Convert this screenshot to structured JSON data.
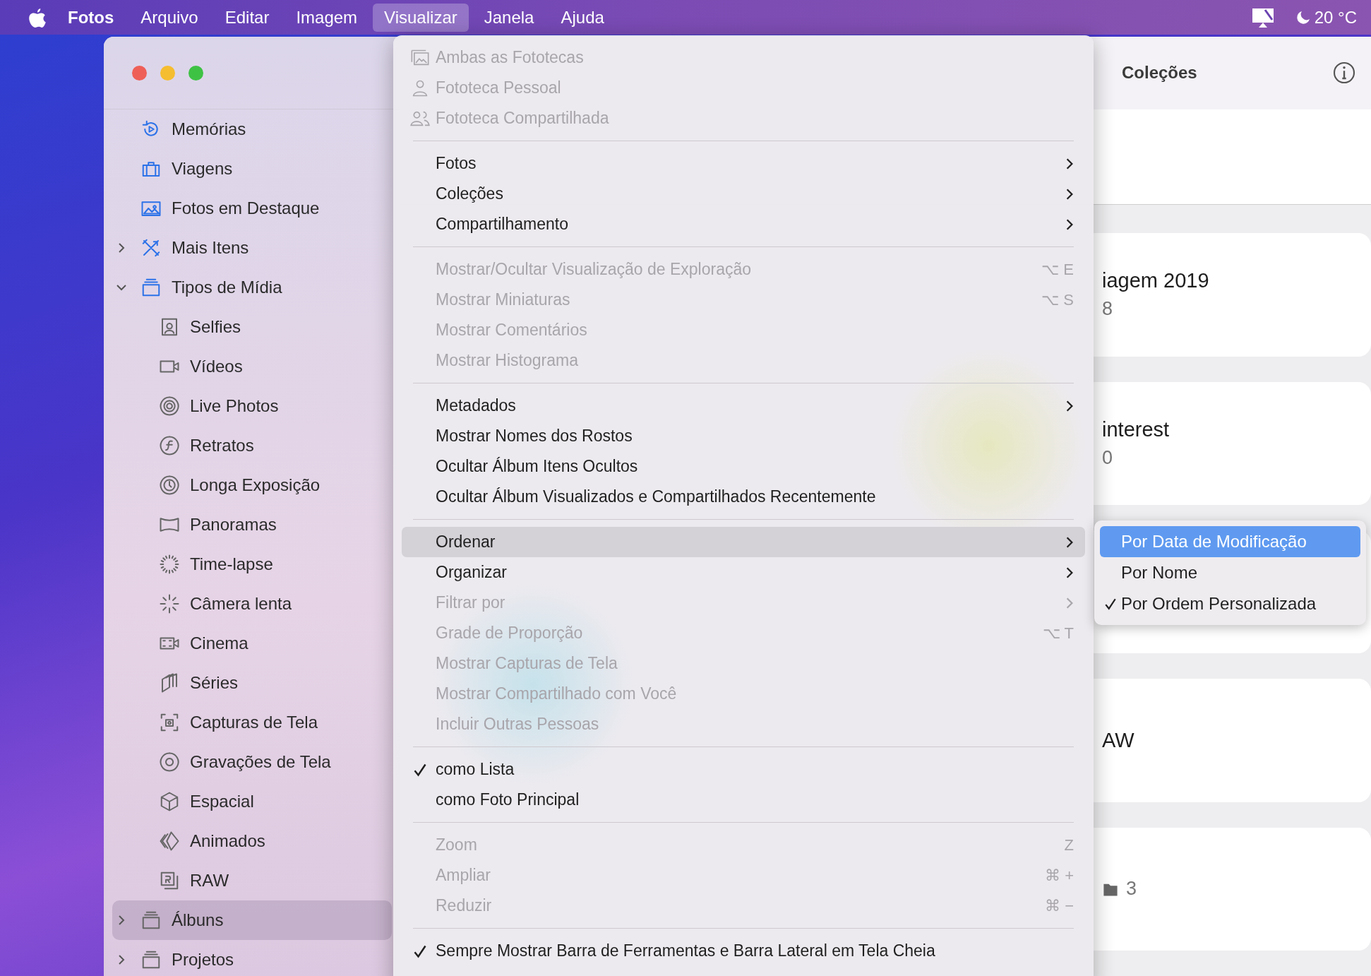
{
  "menu_bar": {
    "app": "Fotos",
    "items": [
      {
        "label": "Arquivo",
        "selected": false
      },
      {
        "label": "Editar",
        "selected": false
      },
      {
        "label": "Imagem",
        "selected": false
      },
      {
        "label": "Visualizar",
        "selected": true
      },
      {
        "label": "Janela",
        "selected": false
      },
      {
        "label": "Ajuda",
        "selected": false
      }
    ],
    "temperature": "20 °C"
  },
  "sidebar": {
    "items": [
      {
        "label": "Memórias",
        "selected": false
      },
      {
        "label": "Viagens",
        "selected": false
      },
      {
        "label": "Fotos em Destaque",
        "selected": false
      },
      {
        "label": "Mais Itens",
        "selected": false,
        "expanded": false
      },
      {
        "label": "Tipos de Mídia",
        "selected": false,
        "expanded": true,
        "children": [
          {
            "label": "Selfies",
            "selected": false
          },
          {
            "label": "Vídeos",
            "selected": false
          },
          {
            "label": "Live Photos",
            "selected": false
          },
          {
            "label": "Retratos",
            "selected": false
          },
          {
            "label": "Longa Exposição",
            "selected": false
          },
          {
            "label": "Panoramas",
            "selected": false
          },
          {
            "label": "Time-lapse",
            "selected": false
          },
          {
            "label": "Câmera lenta",
            "selected": false
          },
          {
            "label": "Cinema",
            "selected": false
          },
          {
            "label": "Séries",
            "selected": false
          },
          {
            "label": "Capturas de Tela",
            "selected": false
          },
          {
            "label": "Gravações de Tela",
            "selected": false
          },
          {
            "label": "Espacial",
            "selected": false
          },
          {
            "label": "Animados",
            "selected": false
          },
          {
            "label": "RAW",
            "selected": false
          }
        ]
      },
      {
        "label": "Álbuns",
        "selected": true,
        "expanded": false
      },
      {
        "label": "Projetos",
        "selected": false,
        "expanded": false
      }
    ]
  },
  "menu": {
    "sections": [
      {
        "items": [
          {
            "label": "Ambas as Fototecas",
            "disabled": true,
            "checked": false,
            "selected": false,
            "submenu": false
          },
          {
            "label": "Fototeca Pessoal",
            "disabled": true,
            "checked": false,
            "selected": false,
            "submenu": false
          },
          {
            "label": "Fototeca Compartilhada",
            "disabled": true,
            "checked": false,
            "selected": false,
            "submenu": false
          }
        ]
      },
      {
        "items": [
          {
            "label": "Fotos",
            "disabled": false,
            "checked": false,
            "selected": false,
            "submenu": true
          },
          {
            "label": "Coleções",
            "disabled": false,
            "checked": false,
            "selected": false,
            "submenu": true
          },
          {
            "label": "Compartilhamento",
            "disabled": false,
            "checked": false,
            "selected": false,
            "submenu": true
          }
        ]
      },
      {
        "items": [
          {
            "label": "Mostrar/Ocultar Visualização de Exploração",
            "disabled": true,
            "checked": false,
            "selected": false,
            "submenu": false,
            "shortcut": "⌥ E"
          },
          {
            "label": "Mostrar Miniaturas",
            "disabled": true,
            "checked": false,
            "selected": false,
            "submenu": false,
            "shortcut": "⌥ S"
          },
          {
            "label": "Mostrar Comentários",
            "disabled": true,
            "checked": false,
            "selected": false,
            "submenu": false
          },
          {
            "label": "Mostrar Histograma",
            "disabled": true,
            "checked": false,
            "selected": false,
            "submenu": false
          }
        ]
      },
      {
        "items": [
          {
            "label": "Metadados",
            "disabled": false,
            "checked": false,
            "selected": false,
            "submenu": true
          },
          {
            "label": "Mostrar Nomes dos Rostos",
            "disabled": false,
            "checked": false,
            "selected": false,
            "submenu": false
          },
          {
            "label": "Ocultar Álbum Itens Ocultos",
            "disabled": false,
            "checked": false,
            "selected": false,
            "submenu": false
          },
          {
            "label": "Ocultar Álbum Visualizados e Compartilhados Recentemente",
            "disabled": false,
            "checked": false,
            "selected": false,
            "submenu": false
          }
        ]
      },
      {
        "items": [
          {
            "label": "Ordenar",
            "disabled": false,
            "checked": false,
            "selected": true,
            "submenu": true
          },
          {
            "label": "Organizar",
            "disabled": false,
            "checked": false,
            "selected": false,
            "submenu": true
          },
          {
            "label": "Filtrar por",
            "disabled": true,
            "checked": false,
            "selected": false,
            "submenu": true
          },
          {
            "label": "Grade de Proporção",
            "disabled": true,
            "checked": false,
            "selected": false,
            "submenu": false,
            "shortcut": "⌥ T"
          },
          {
            "label": "Mostrar Capturas de Tela",
            "disabled": true,
            "checked": false,
            "selected": false,
            "submenu": false
          },
          {
            "label": "Mostrar Compartilhado com Você",
            "disabled": true,
            "checked": false,
            "selected": false,
            "submenu": false
          },
          {
            "label": "Incluir Outras Pessoas",
            "disabled": true,
            "checked": false,
            "selected": false,
            "submenu": false
          }
        ]
      },
      {
        "items": [
          {
            "label": "como Lista",
            "disabled": false,
            "checked": true,
            "selected": false,
            "submenu": false
          },
          {
            "label": "como Foto Principal",
            "disabled": false,
            "checked": false,
            "selected": false,
            "submenu": false
          }
        ]
      },
      {
        "items": [
          {
            "label": "Zoom",
            "disabled": true,
            "checked": false,
            "selected": false,
            "submenu": false,
            "shortcut": "Z"
          },
          {
            "label": "Ampliar",
            "disabled": true,
            "checked": false,
            "selected": false,
            "submenu": false,
            "shortcut": "⌘ +"
          },
          {
            "label": "Reduzir",
            "disabled": true,
            "checked": false,
            "selected": false,
            "submenu": false,
            "shortcut": "⌘ −"
          }
        ]
      },
      {
        "items": [
          {
            "label": "Sempre Mostrar Barra de Ferramentas e Barra Lateral em Tela Cheia",
            "disabled": false,
            "checked": true,
            "selected": false,
            "submenu": false
          }
        ]
      }
    ]
  },
  "submenu": {
    "items": [
      {
        "label": "Por Data de Modificação",
        "selected": true,
        "checked": false
      },
      {
        "label": "Por Nome",
        "selected": false,
        "checked": false
      },
      {
        "label": "Por Ordem Personalizada",
        "selected": false,
        "checked": true
      }
    ]
  },
  "panel": {
    "title": "Coleções",
    "cards": [
      {
        "title": "iagem 2019",
        "count": "8"
      },
      {
        "title": "interest",
        "count": "0"
      },
      {
        "title": "AW"
      },
      {
        "count": "3"
      }
    ]
  }
}
